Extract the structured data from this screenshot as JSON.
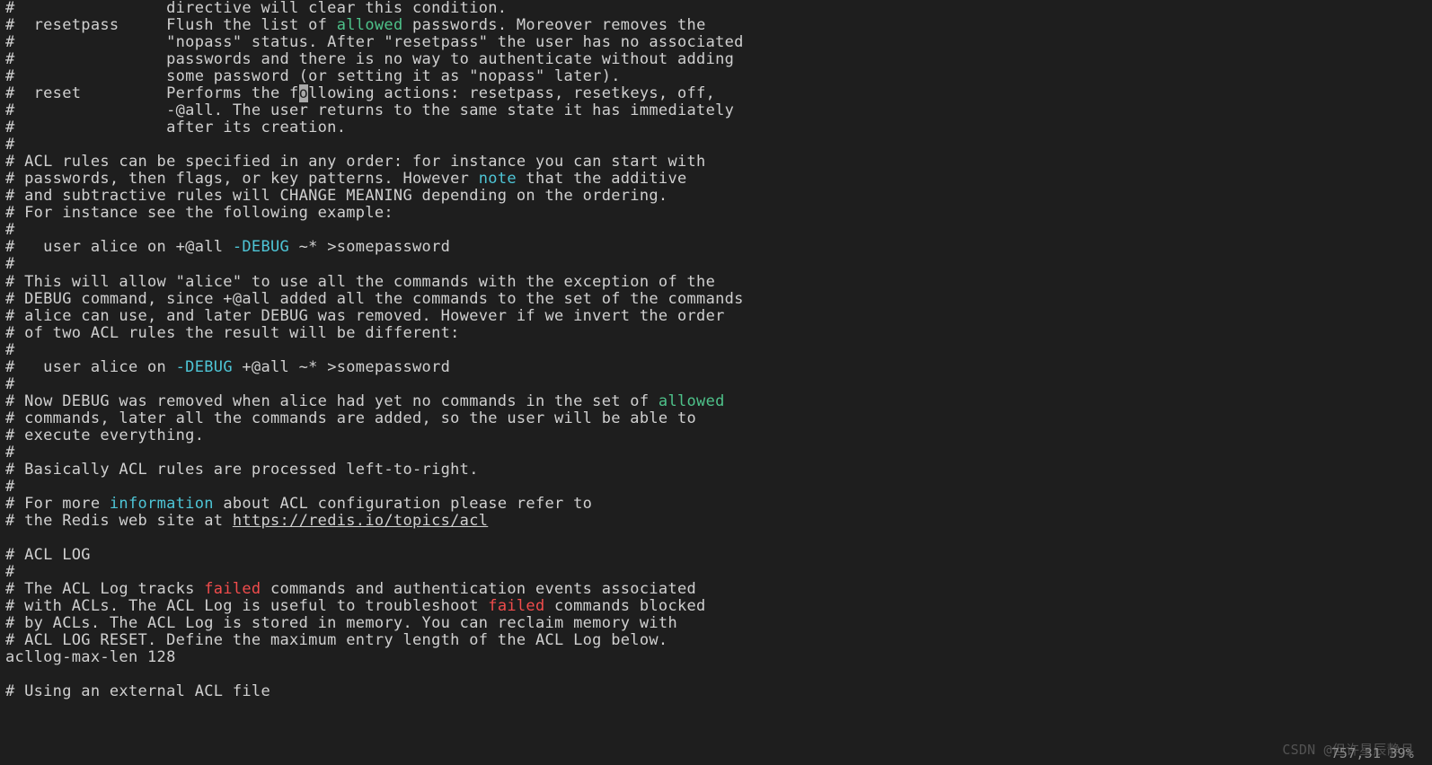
{
  "lines": [
    {
      "segs": [
        {
          "t": "#                directive will clear this condition."
        }
      ]
    },
    {
      "segs": [
        {
          "t": "#  resetpass     Flush the list of "
        },
        {
          "t": "allowed",
          "cls": "g"
        },
        {
          "t": " passwords. Moreover removes the"
        }
      ]
    },
    {
      "segs": [
        {
          "t": "#                \"nopass\" status. After \"resetpass\" the user has no associated"
        }
      ]
    },
    {
      "segs": [
        {
          "t": "#                passwords and there is no way to authenticate without adding"
        }
      ]
    },
    {
      "segs": [
        {
          "t": "#                some password (or setting it as \"nopass\" later)."
        }
      ]
    },
    {
      "segs": [
        {
          "t": "#  reset         Performs the f"
        },
        {
          "t": "o",
          "cls": "cur"
        },
        {
          "t": "llowing actions: resetpass, resetkeys, off,"
        }
      ]
    },
    {
      "segs": [
        {
          "t": "#                -@all. The user returns to the same state it has immediately"
        }
      ]
    },
    {
      "segs": [
        {
          "t": "#                after its creation."
        }
      ]
    },
    {
      "segs": [
        {
          "t": "#"
        }
      ]
    },
    {
      "segs": [
        {
          "t": "# ACL rules can be specified in any order: for instance you can start with"
        }
      ]
    },
    {
      "segs": [
        {
          "t": "# passwords, then flags, or key patterns. However "
        },
        {
          "t": "note",
          "cls": "b"
        },
        {
          "t": " that the additive"
        }
      ]
    },
    {
      "segs": [
        {
          "t": "# and subtractive rules will CHANGE MEANING depending on the ordering."
        }
      ]
    },
    {
      "segs": [
        {
          "t": "# For instance see the following example:"
        }
      ]
    },
    {
      "segs": [
        {
          "t": "#"
        }
      ]
    },
    {
      "segs": [
        {
          "t": "#   user alice on +@all "
        },
        {
          "t": "-DEBUG",
          "cls": "teal"
        },
        {
          "t": " ~* >somepassword"
        }
      ]
    },
    {
      "segs": [
        {
          "t": "#"
        }
      ]
    },
    {
      "segs": [
        {
          "t": "# This will allow \"alice\" to use all the commands with the exception of the"
        }
      ]
    },
    {
      "segs": [
        {
          "t": "# DEBUG command, since +@all added all the commands to the set of the commands"
        }
      ]
    },
    {
      "segs": [
        {
          "t": "# alice can use, and later DEBUG was removed. However if we invert the order"
        }
      ]
    },
    {
      "segs": [
        {
          "t": "# of two ACL rules the result will be different:"
        }
      ]
    },
    {
      "segs": [
        {
          "t": "#"
        }
      ]
    },
    {
      "segs": [
        {
          "t": "#   user alice on "
        },
        {
          "t": "-DEBUG",
          "cls": "teal"
        },
        {
          "t": " +@all ~* >somepassword"
        }
      ]
    },
    {
      "segs": [
        {
          "t": "#"
        }
      ]
    },
    {
      "segs": [
        {
          "t": "# Now DEBUG was removed when alice had yet no commands in the set of "
        },
        {
          "t": "allowed",
          "cls": "g"
        }
      ]
    },
    {
      "segs": [
        {
          "t": "# commands, later all the commands are added, so the user will be able to"
        }
      ]
    },
    {
      "segs": [
        {
          "t": "# execute everything."
        }
      ]
    },
    {
      "segs": [
        {
          "t": "#"
        }
      ]
    },
    {
      "segs": [
        {
          "t": "# Basically ACL rules are processed left-to-right."
        }
      ]
    },
    {
      "segs": [
        {
          "t": "#"
        }
      ]
    },
    {
      "segs": [
        {
          "t": "# For more "
        },
        {
          "t": "information",
          "cls": "b"
        },
        {
          "t": " about ACL configuration please refer to"
        }
      ]
    },
    {
      "segs": [
        {
          "t": "# the Redis web site at "
        },
        {
          "t": "https://redis.io/topics/acl",
          "cls": "u"
        }
      ]
    },
    {
      "segs": [
        {
          "t": ""
        }
      ]
    },
    {
      "segs": [
        {
          "t": "# ACL LOG"
        }
      ]
    },
    {
      "segs": [
        {
          "t": "#"
        }
      ]
    },
    {
      "segs": [
        {
          "t": "# The ACL Log tracks "
        },
        {
          "t": "failed",
          "cls": "r"
        },
        {
          "t": " commands and authentication events associated"
        }
      ]
    },
    {
      "segs": [
        {
          "t": "# with ACLs. The ACL Log is useful to troubleshoot "
        },
        {
          "t": "failed",
          "cls": "r"
        },
        {
          "t": " commands blocked"
        }
      ]
    },
    {
      "segs": [
        {
          "t": "# by ACLs. The ACL Log is stored in memory. You can reclaim memory with"
        }
      ]
    },
    {
      "segs": [
        {
          "t": "# ACL LOG RESET. Define the maximum entry length of the ACL Log below."
        }
      ]
    },
    {
      "segs": [
        {
          "t": "acllog-max-len 128"
        }
      ]
    },
    {
      "segs": [
        {
          "t": ""
        }
      ]
    },
    {
      "segs": [
        {
          "t": "# Using an external ACL file"
        }
      ]
    }
  ],
  "status": "757,31        39%",
  "watermark": "CSDN @但许星辰静月"
}
